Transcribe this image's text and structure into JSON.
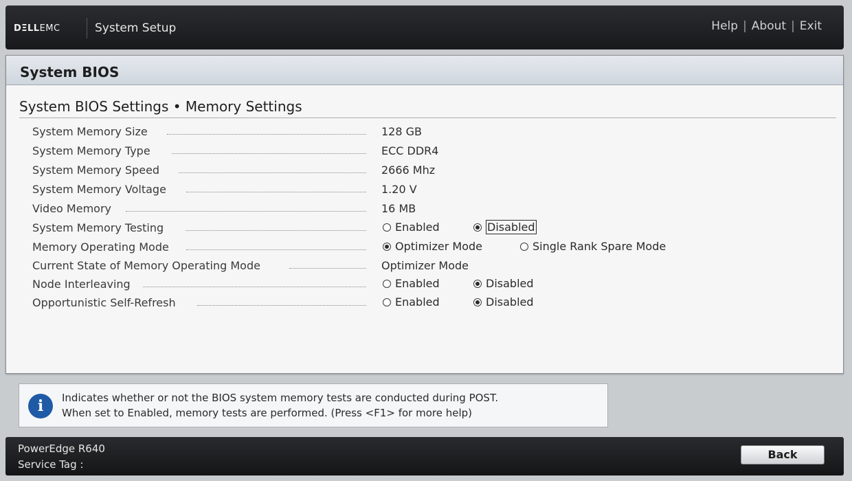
{
  "header": {
    "logo_dell": "DΞLL",
    "logo_emc": "EMC",
    "title": "System Setup",
    "links": [
      "Help",
      "About",
      "Exit"
    ],
    "link_separator": "|"
  },
  "panel": {
    "title": "System BIOS",
    "section_title": "System BIOS Settings • Memory Settings"
  },
  "settings": [
    {
      "label": "System Memory Size",
      "value": "128 GB"
    },
    {
      "label": "System Memory Type",
      "value": "ECC DDR4"
    },
    {
      "label": "System Memory Speed",
      "value": "2666 Mhz"
    },
    {
      "label": "System Memory Voltage",
      "value": "1.20 V"
    },
    {
      "label": "Video Memory",
      "value": "16 MB"
    },
    {
      "label": "System Memory Testing",
      "options": [
        "Enabled",
        "Disabled"
      ],
      "selected": "Disabled",
      "focused": "Disabled"
    },
    {
      "label": "Memory Operating Mode",
      "options": [
        "Optimizer Mode",
        "Single Rank Spare Mode"
      ],
      "selected": "Optimizer Mode"
    },
    {
      "label": "Current State of Memory Operating Mode",
      "value": "Optimizer Mode"
    },
    {
      "label": "Node Interleaving",
      "options": [
        "Enabled",
        "Disabled"
      ],
      "selected": "Disabled"
    },
    {
      "label": "Opportunistic Self-Refresh",
      "options": [
        "Enabled",
        "Disabled"
      ],
      "selected": "Disabled"
    }
  ],
  "help": {
    "icon": "info-icon",
    "icon_glyph": "i",
    "line1": "Indicates whether or not the BIOS system memory tests are conducted during POST.",
    "line2": "When set to Enabled, memory tests are performed. (Press <F1> for more help)"
  },
  "footer": {
    "model": "PowerEdge R640",
    "service_tag": "Service Tag :",
    "back_label": "Back"
  },
  "colors": {
    "header_bg": "#1f2022",
    "panel_header_bg": "#d9dfe6",
    "info_icon": "#1f5aa6"
  }
}
